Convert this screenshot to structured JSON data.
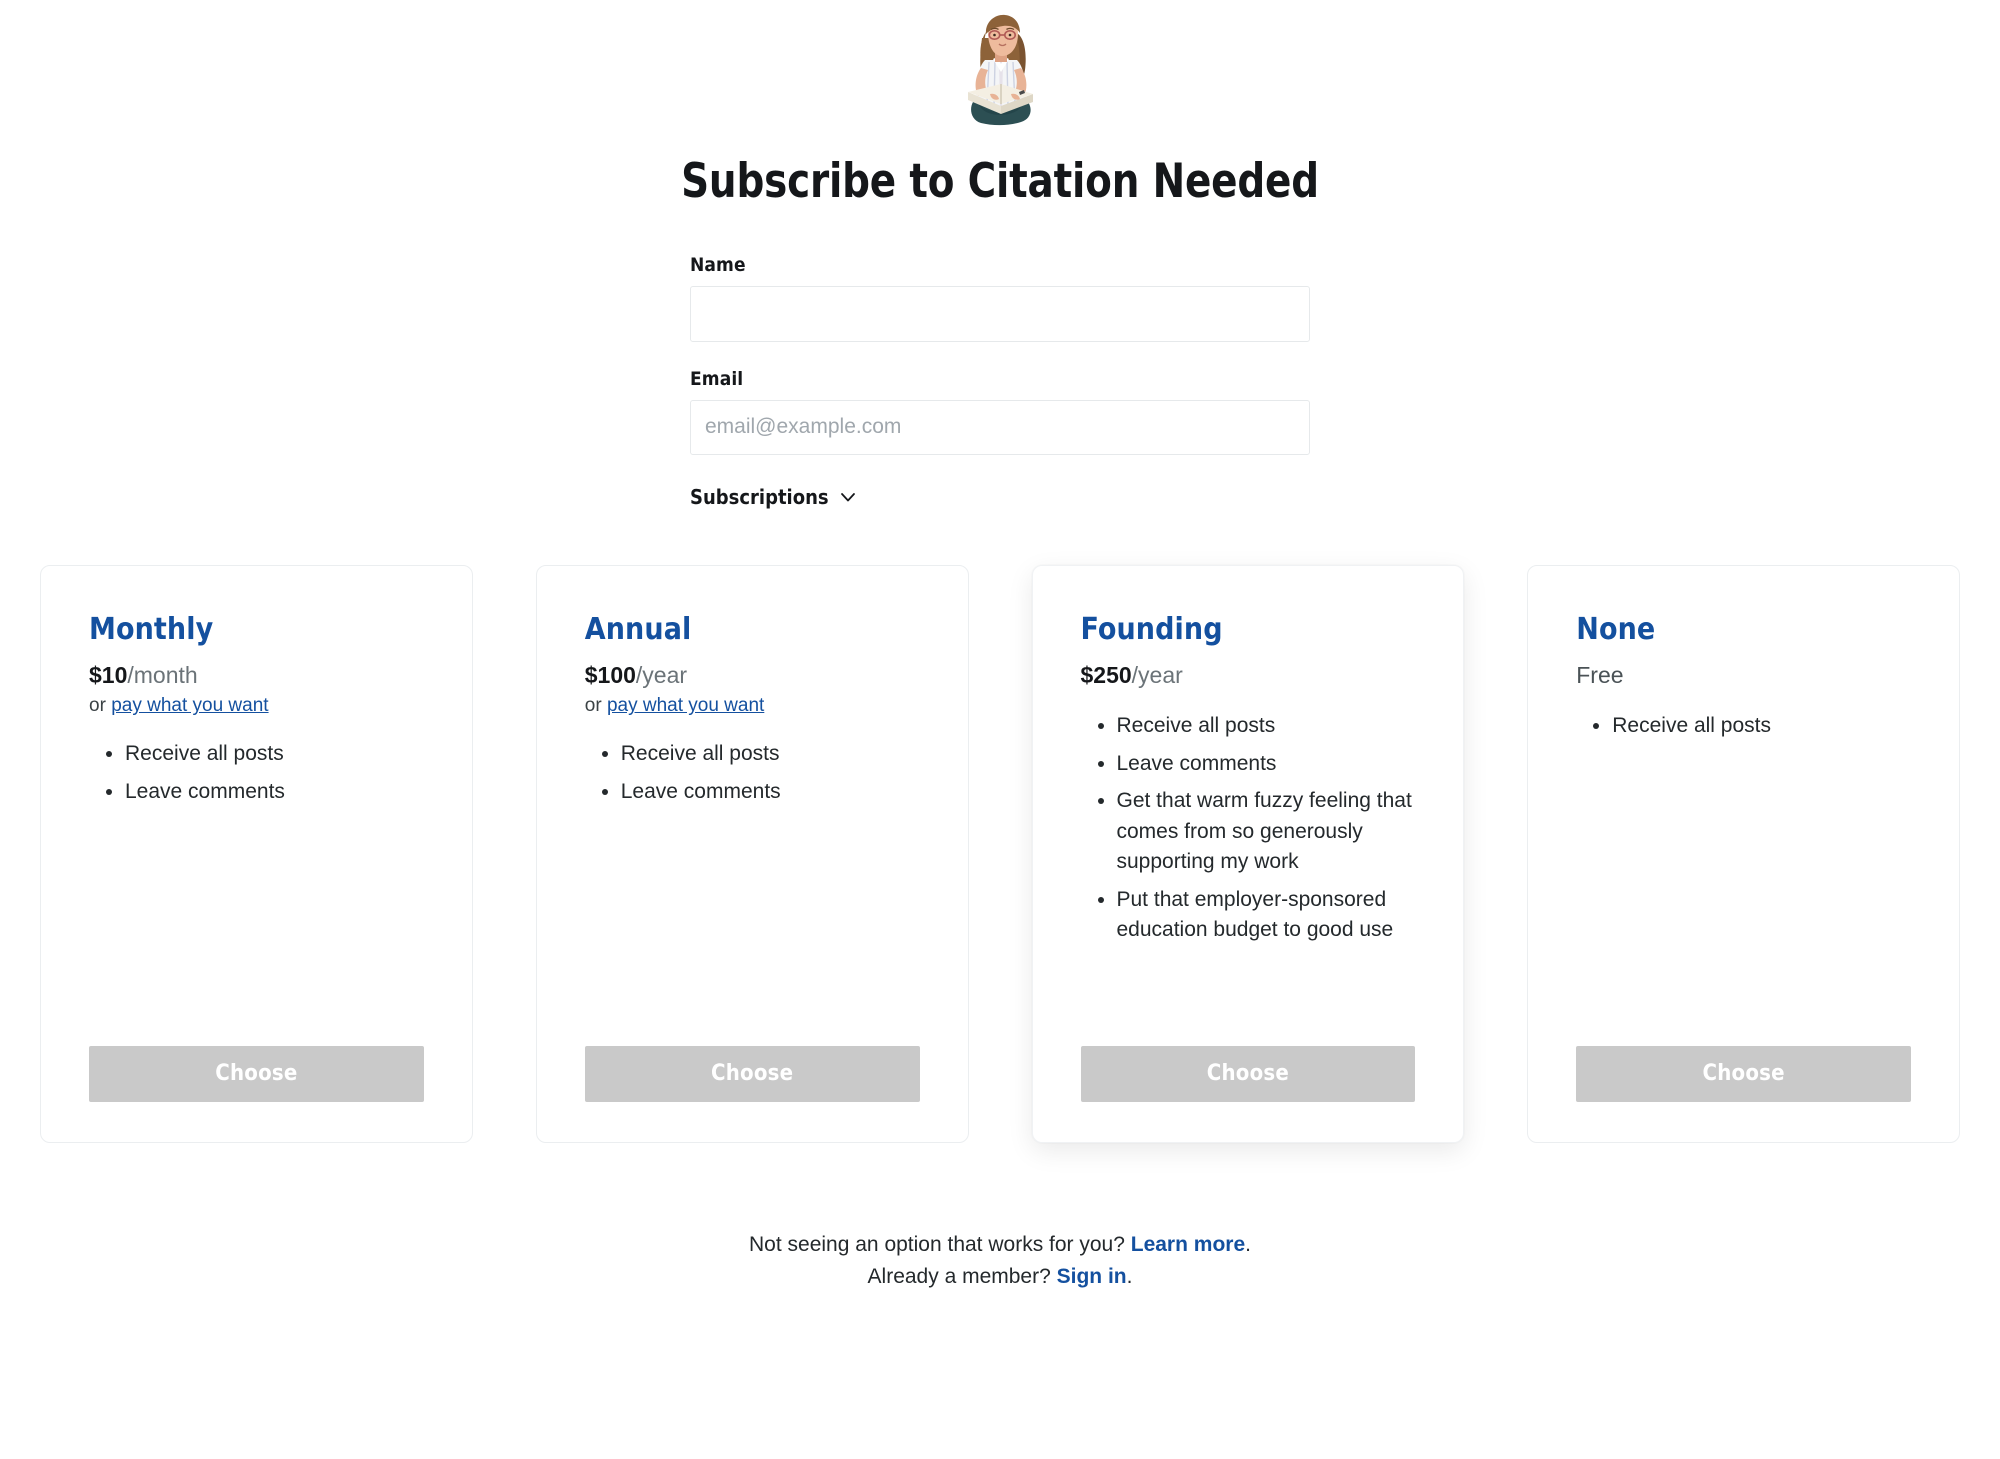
{
  "header": {
    "avatar_icon": "reading-woman-avatar",
    "title": "Subscribe to Citation Needed"
  },
  "form": {
    "name": {
      "label": "Name",
      "value": "",
      "placeholder": ""
    },
    "email": {
      "label": "Email",
      "value": "",
      "placeholder": "email@example.com"
    },
    "subscriptions_toggle": {
      "label": "Subscriptions",
      "icon": "chevron-down-icon"
    }
  },
  "tiers": [
    {
      "name": "Monthly",
      "price_amount": "$10",
      "price_period": "/month",
      "pwyw_prefix": "or ",
      "pwyw_link": "pay what you want",
      "benefits": [
        "Receive all posts",
        "Leave comments"
      ],
      "choose_label": "Choose",
      "featured": false
    },
    {
      "name": "Annual",
      "price_amount": "$100",
      "price_period": "/year",
      "pwyw_prefix": "or ",
      "pwyw_link": "pay what you want",
      "benefits": [
        "Receive all posts",
        "Leave comments"
      ],
      "choose_label": "Choose",
      "featured": false
    },
    {
      "name": "Founding",
      "price_amount": "$250",
      "price_period": "/year",
      "pwyw_prefix": "",
      "pwyw_link": "",
      "benefits": [
        "Receive all posts",
        "Leave comments",
        "Get that warm fuzzy feeling that comes from so generously supporting my work",
        "Put that employer-sponsored education budget to good use"
      ],
      "choose_label": "Choose",
      "featured": true
    },
    {
      "name": "None",
      "price_amount": "",
      "price_period": "Free",
      "pwyw_prefix": "",
      "pwyw_link": "",
      "benefits": [
        "Receive all posts"
      ],
      "choose_label": "Choose",
      "featured": false
    }
  ],
  "footer": {
    "line1_text": "Not seeing an option that works for you? ",
    "line1_link": "Learn more",
    "line1_suffix": ".",
    "line2_text": "Already a member? ",
    "line2_link": "Sign in",
    "line2_suffix": "."
  },
  "colors": {
    "accent_blue": "#14509f",
    "text": "#15171a",
    "muted": "#6b7378",
    "button_gray": "#c9c9c9",
    "card_border": "#ebeef0"
  }
}
